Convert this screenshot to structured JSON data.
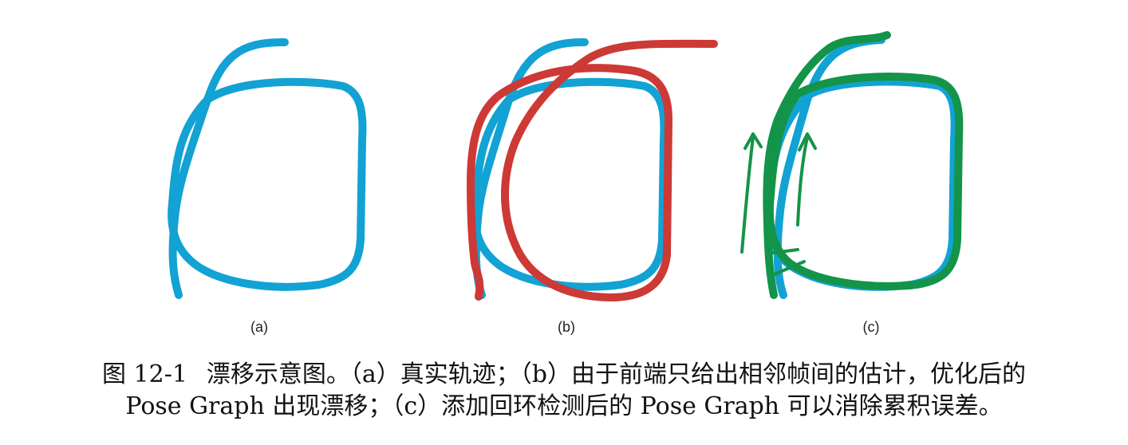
{
  "figure": {
    "panels": [
      {
        "label": "(a)"
      },
      {
        "label": "(b)"
      },
      {
        "label": "(c)"
      }
    ],
    "colors": {
      "true_trajectory": "#12a2d4",
      "drifted_trajectory": "#cd3935",
      "corrected_trajectory": "#139448"
    }
  },
  "caption": {
    "figure_number": "图 12-1",
    "line1_text": "漂移示意图。（a）真实轨迹；（b）由于前端只给出相邻帧间的估计，优化后的",
    "line2_text": "Pose Graph 出现漂移；（c）添加回环检测后的 Pose Graph 可以消除累积误差。"
  }
}
